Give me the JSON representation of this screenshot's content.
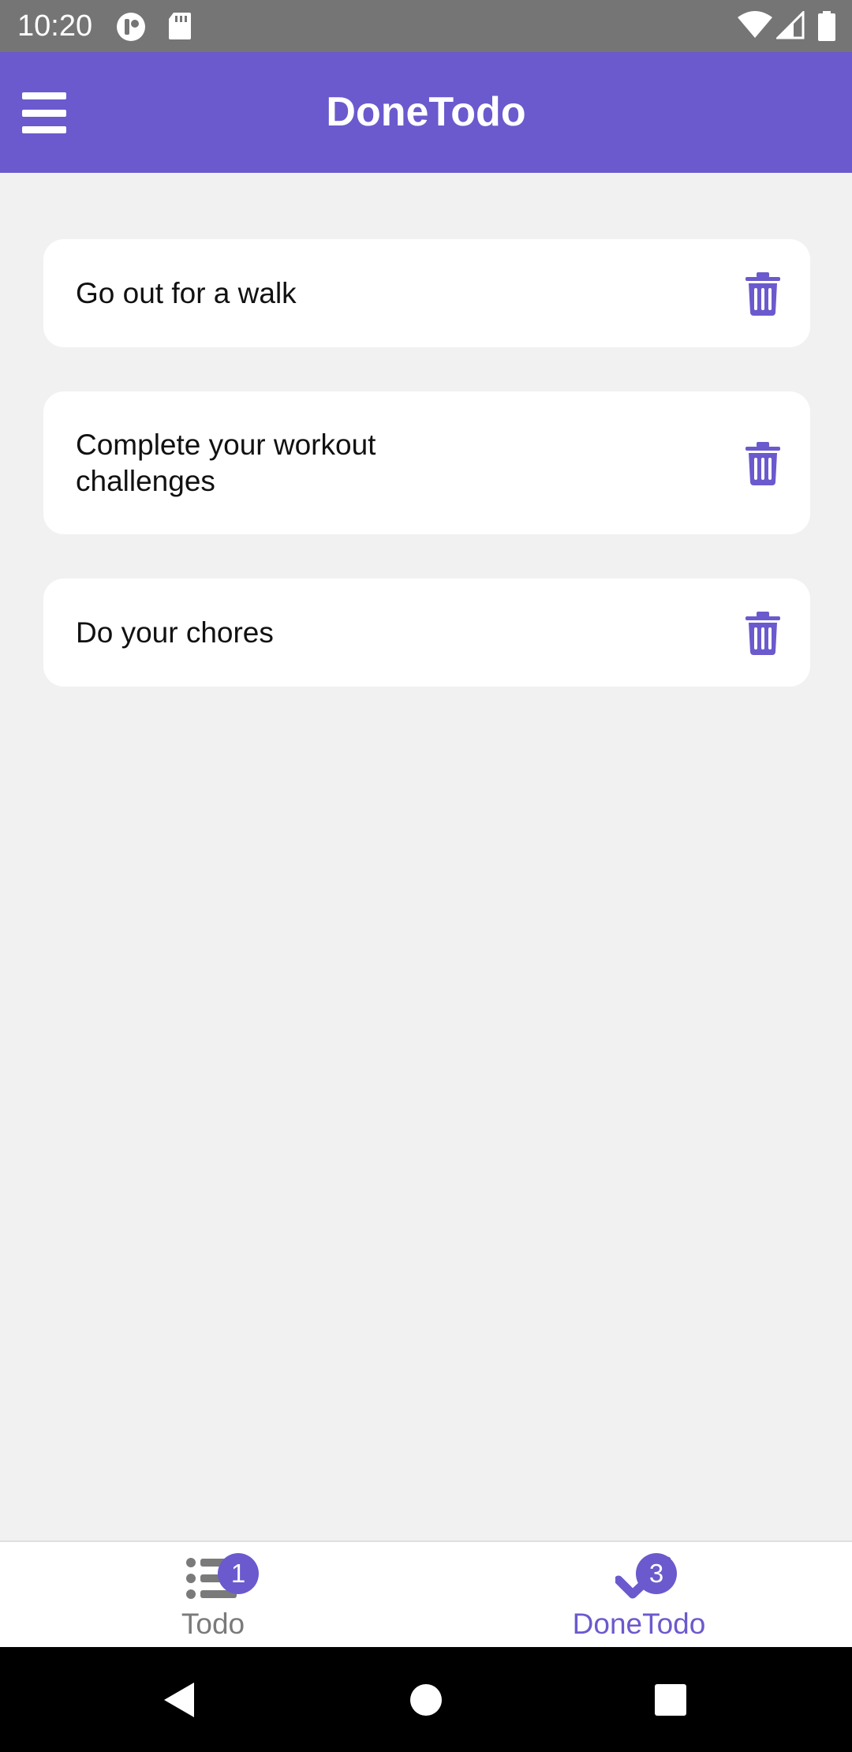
{
  "status_bar": {
    "time": "10:20",
    "icons": [
      "record-icon",
      "sd-card-icon",
      "wifi-icon",
      "signal-icon",
      "battery-icon"
    ]
  },
  "app_bar": {
    "title": "DoneTodo",
    "menu_icon": "hamburger-menu-icon"
  },
  "todos": [
    {
      "text": "Go out for a walk",
      "action_icon": "trash-icon"
    },
    {
      "text": "Complete your workout challenges",
      "action_icon": "trash-icon"
    },
    {
      "text": "Do your chores",
      "action_icon": "trash-icon"
    }
  ],
  "bottom_nav": {
    "tabs": [
      {
        "label": "Todo",
        "badge": "1",
        "icon": "list-icon",
        "active": false
      },
      {
        "label": "DoneTodo",
        "badge": "3",
        "icon": "checkmark-icon",
        "active": true
      }
    ]
  },
  "system_nav": {
    "icons": [
      "back-icon",
      "home-icon",
      "recents-icon"
    ]
  },
  "colors": {
    "accent": "#6a5acd",
    "status_bar": "#757575",
    "background": "#f1f1f1",
    "inactive_tab": "#7a7a7a"
  }
}
